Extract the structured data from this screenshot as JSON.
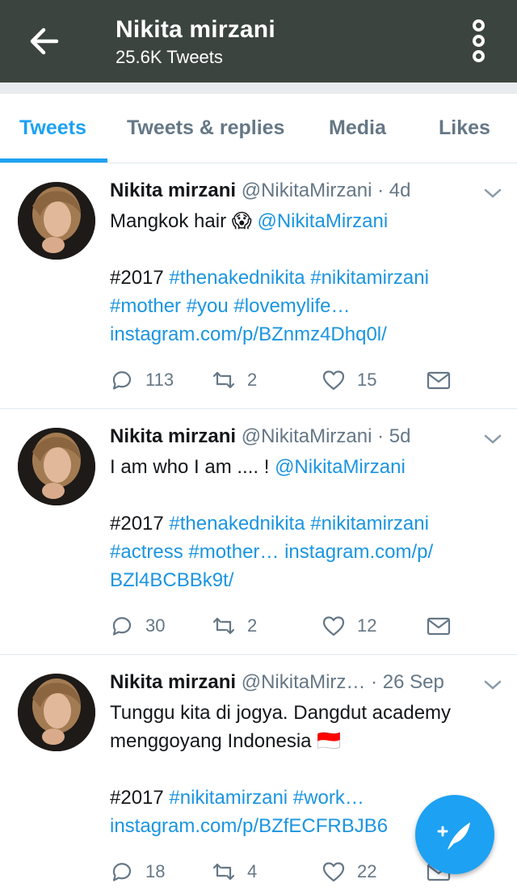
{
  "header": {
    "title": "Nikita mirzani",
    "subtitle": "25.6K Tweets"
  },
  "tabs": [
    {
      "label": "Tweets",
      "active": true
    },
    {
      "label": "Tweets & replies",
      "active": false
    },
    {
      "label": "Media",
      "active": false
    },
    {
      "label": "Likes",
      "active": false
    }
  ],
  "tweets": [
    {
      "name": "Nikita mirzani",
      "handle": "@NikitaMirzani",
      "time": "· 4d",
      "line1_text": "Mangkok hair ",
      "line1_emoji": "😱",
      "line1_mention": " @NikitaMirzani",
      "line2_a": "#2017",
      "line2_b": " #thenakednikita #nikitamirzani",
      "line3": "#mother #you #lovemylife…",
      "line4": "instagram.com/p/BZnmz4Dhq0l/",
      "replies": "113",
      "retweets": "2",
      "likes": "15"
    },
    {
      "name": "Nikita mirzani",
      "handle": "@NikitaMirzani",
      "time": "· 5d",
      "line1_text": "I am who I am .... ! ",
      "line1_mention": "@NikitaMirzani",
      "line2_a": "#2017",
      "line2_b": " #thenakednikita #nikitamirzani",
      "line3": "#actress #mother… instagram.com/p/",
      "line4": "BZl4BCBBk9t/",
      "replies": "30",
      "retweets": "2",
      "likes": "12"
    },
    {
      "name": "Nikita mirzani",
      "handle": "@NikitaMirz…",
      "time": "· 26 Sep",
      "line1_text": "Tunggu kita di jogya. Dangdut academy",
      "line1b_text": "menggoyang Indonesia ",
      "line1b_emoji": "🇮🇩",
      "line2_a": "#2017",
      "line2_b": " #nikitamirzani #work…",
      "line4": "instagram.com/p/BZfECFRBJB6",
      "replies": "18",
      "retweets": "4",
      "likes": "22"
    }
  ],
  "colors": {
    "header_bg": "#3c4440",
    "accent": "#1da1f2",
    "link": "#1b95e0",
    "muted": "#657786"
  },
  "icons": [
    "back-arrow-icon",
    "more-vertical-icon",
    "reply-icon",
    "retweet-icon",
    "like-icon",
    "direct-message-icon",
    "chevron-down-icon",
    "compose-tweet-icon"
  ]
}
